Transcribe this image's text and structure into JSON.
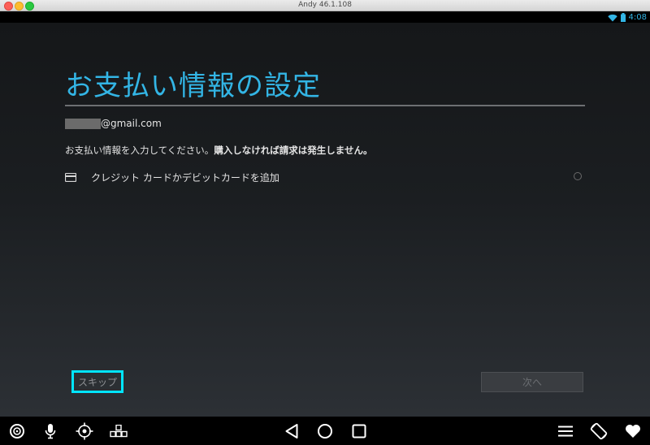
{
  "window": {
    "title": "Andy 46.1.108"
  },
  "status_bar": {
    "time": "4:08",
    "icons": [
      "wifi-icon",
      "battery-icon"
    ]
  },
  "page": {
    "title": "お支払い情報の設定",
    "account_suffix": "@gmail.com",
    "description_normal": "お支払い情報を入力してください。",
    "description_bold": "購入しなければ請求は発生しません。",
    "payment_options": [
      {
        "label": "クレジット カードかデビットカードを追加",
        "icon": "credit-card-icon",
        "selected": false
      }
    ]
  },
  "buttons": {
    "skip_label": "スキップ",
    "next_label": "次へ"
  },
  "navbar": {
    "left_icons": [
      "target-icon",
      "microphone-icon",
      "crosshair-icon",
      "keyboard-icon"
    ],
    "center_icons": [
      "back-icon",
      "home-icon",
      "recents-icon"
    ],
    "right_icons": [
      "menu-icon",
      "rotate-icon",
      "heart-icon"
    ]
  },
  "colors": {
    "accent": "#33b5e5",
    "focus_ring": "#00e5ff",
    "text": "#e4e4e4"
  }
}
